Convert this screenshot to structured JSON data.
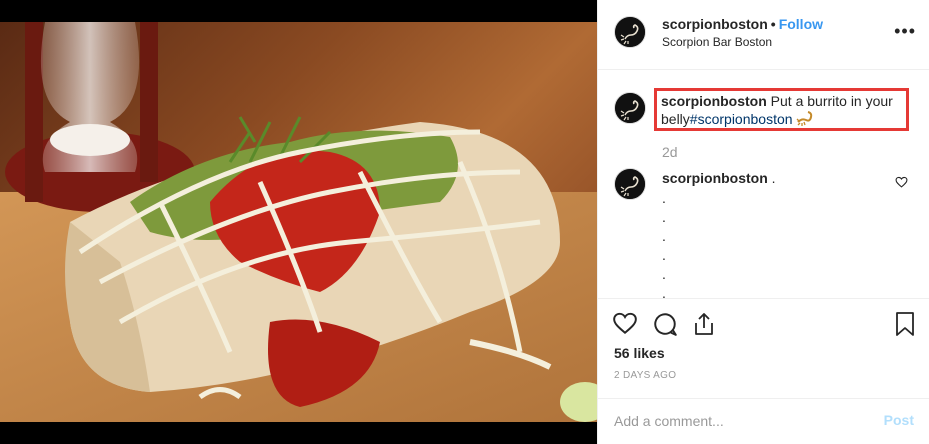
{
  "post": {
    "username": "scorpionboston",
    "follow_label": "Follow",
    "separator": "•",
    "location": "Scorpion Bar Boston",
    "more_label": "•••",
    "caption": {
      "username": "scorpionboston",
      "text": "Put a burrito in your belly",
      "hashtag": "#scorpionboston",
      "time": "2d"
    },
    "comment": {
      "username": "scorpionboston",
      "text": ".",
      "dots": [
        ".",
        ".",
        ".",
        ".",
        ".",
        "."
      ]
    },
    "likes": "56 likes",
    "time_ago": "2 DAYS AGO",
    "add_comment_placeholder": "Add a comment...",
    "post_label": "Post"
  },
  "icons": {
    "like": "heart-icon",
    "comment": "comment-icon",
    "share": "share-icon",
    "save": "bookmark-icon",
    "more": "more-options-icon",
    "caption_emoji": "scorpion-emoji-icon"
  },
  "colors": {
    "link": "#3897f0",
    "hashtag": "#003569",
    "highlight": "#e53935",
    "muted": "#999999",
    "post_disabled": "#b2dffc"
  }
}
